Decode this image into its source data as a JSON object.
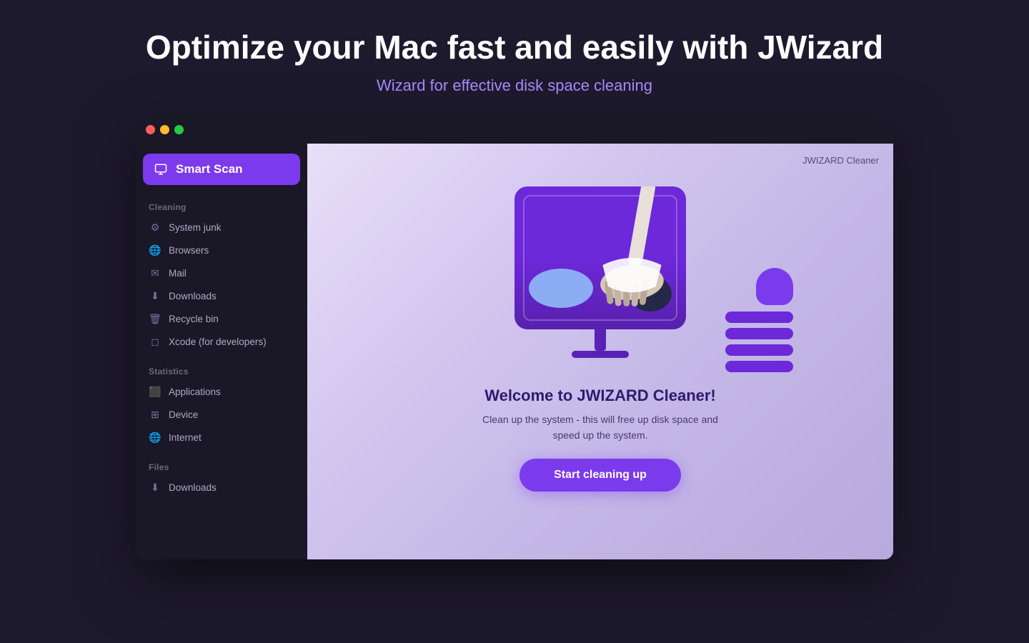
{
  "page": {
    "title": "Optimize your Mac fast and easily with JWizard",
    "subtitle": "Wizard for effective disk space cleaning"
  },
  "app": {
    "brand": "JWIZARD Cleaner",
    "window_buttons": [
      "close",
      "minimize",
      "maximize"
    ]
  },
  "sidebar": {
    "smart_scan_label": "Smart Scan",
    "sections": [
      {
        "label": "Cleaning",
        "items": [
          {
            "id": "system-junk",
            "label": "System junk"
          },
          {
            "id": "browsers",
            "label": "Browsers"
          },
          {
            "id": "mail",
            "label": "Mail"
          },
          {
            "id": "downloads",
            "label": "Downloads"
          },
          {
            "id": "recycle-bin",
            "label": "Recycle bin"
          },
          {
            "id": "xcode",
            "label": "Xcode (for developers)"
          }
        ]
      },
      {
        "label": "Statistics",
        "items": [
          {
            "id": "applications",
            "label": "Applications"
          },
          {
            "id": "device",
            "label": "Device"
          },
          {
            "id": "internet",
            "label": "Internet"
          }
        ]
      },
      {
        "label": "Files",
        "items": [
          {
            "id": "files-downloads",
            "label": "Downloads"
          }
        ]
      }
    ]
  },
  "main": {
    "welcome_title": "Welcome to JWIZARD Cleaner!",
    "welcome_desc_line1": "Clean up the system - this will free up disk space and",
    "welcome_desc_line2": "speed up the system.",
    "start_button_label": "Start cleaning up"
  }
}
